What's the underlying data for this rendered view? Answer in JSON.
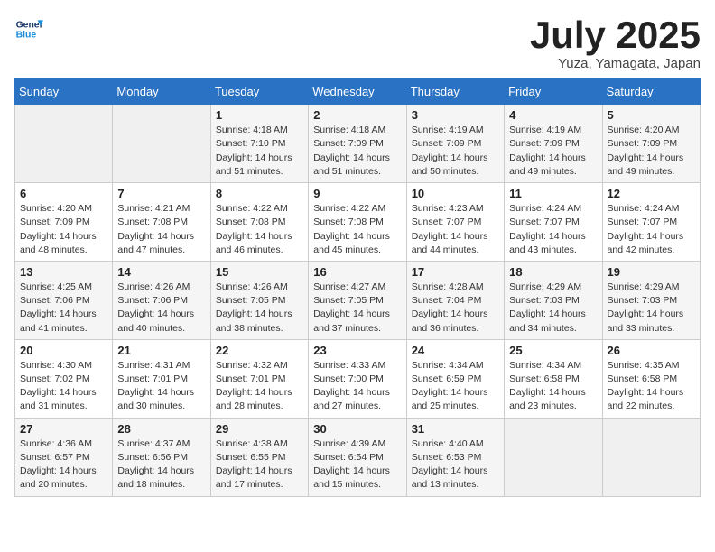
{
  "header": {
    "logo_line1": "General",
    "logo_line2": "Blue",
    "month_title": "July 2025",
    "location": "Yuza, Yamagata, Japan"
  },
  "weekdays": [
    "Sunday",
    "Monday",
    "Tuesday",
    "Wednesday",
    "Thursday",
    "Friday",
    "Saturday"
  ],
  "weeks": [
    [
      {
        "day": "",
        "sunrise": "",
        "sunset": "",
        "daylight": ""
      },
      {
        "day": "",
        "sunrise": "",
        "sunset": "",
        "daylight": ""
      },
      {
        "day": "1",
        "sunrise": "Sunrise: 4:18 AM",
        "sunset": "Sunset: 7:10 PM",
        "daylight": "Daylight: 14 hours and 51 minutes."
      },
      {
        "day": "2",
        "sunrise": "Sunrise: 4:18 AM",
        "sunset": "Sunset: 7:09 PM",
        "daylight": "Daylight: 14 hours and 51 minutes."
      },
      {
        "day": "3",
        "sunrise": "Sunrise: 4:19 AM",
        "sunset": "Sunset: 7:09 PM",
        "daylight": "Daylight: 14 hours and 50 minutes."
      },
      {
        "day": "4",
        "sunrise": "Sunrise: 4:19 AM",
        "sunset": "Sunset: 7:09 PM",
        "daylight": "Daylight: 14 hours and 49 minutes."
      },
      {
        "day": "5",
        "sunrise": "Sunrise: 4:20 AM",
        "sunset": "Sunset: 7:09 PM",
        "daylight": "Daylight: 14 hours and 49 minutes."
      }
    ],
    [
      {
        "day": "6",
        "sunrise": "Sunrise: 4:20 AM",
        "sunset": "Sunset: 7:09 PM",
        "daylight": "Daylight: 14 hours and 48 minutes."
      },
      {
        "day": "7",
        "sunrise": "Sunrise: 4:21 AM",
        "sunset": "Sunset: 7:08 PM",
        "daylight": "Daylight: 14 hours and 47 minutes."
      },
      {
        "day": "8",
        "sunrise": "Sunrise: 4:22 AM",
        "sunset": "Sunset: 7:08 PM",
        "daylight": "Daylight: 14 hours and 46 minutes."
      },
      {
        "day": "9",
        "sunrise": "Sunrise: 4:22 AM",
        "sunset": "Sunset: 7:08 PM",
        "daylight": "Daylight: 14 hours and 45 minutes."
      },
      {
        "day": "10",
        "sunrise": "Sunrise: 4:23 AM",
        "sunset": "Sunset: 7:07 PM",
        "daylight": "Daylight: 14 hours and 44 minutes."
      },
      {
        "day": "11",
        "sunrise": "Sunrise: 4:24 AM",
        "sunset": "Sunset: 7:07 PM",
        "daylight": "Daylight: 14 hours and 43 minutes."
      },
      {
        "day": "12",
        "sunrise": "Sunrise: 4:24 AM",
        "sunset": "Sunset: 7:07 PM",
        "daylight": "Daylight: 14 hours and 42 minutes."
      }
    ],
    [
      {
        "day": "13",
        "sunrise": "Sunrise: 4:25 AM",
        "sunset": "Sunset: 7:06 PM",
        "daylight": "Daylight: 14 hours and 41 minutes."
      },
      {
        "day": "14",
        "sunrise": "Sunrise: 4:26 AM",
        "sunset": "Sunset: 7:06 PM",
        "daylight": "Daylight: 14 hours and 40 minutes."
      },
      {
        "day": "15",
        "sunrise": "Sunrise: 4:26 AM",
        "sunset": "Sunset: 7:05 PM",
        "daylight": "Daylight: 14 hours and 38 minutes."
      },
      {
        "day": "16",
        "sunrise": "Sunrise: 4:27 AM",
        "sunset": "Sunset: 7:05 PM",
        "daylight": "Daylight: 14 hours and 37 minutes."
      },
      {
        "day": "17",
        "sunrise": "Sunrise: 4:28 AM",
        "sunset": "Sunset: 7:04 PM",
        "daylight": "Daylight: 14 hours and 36 minutes."
      },
      {
        "day": "18",
        "sunrise": "Sunrise: 4:29 AM",
        "sunset": "Sunset: 7:03 PM",
        "daylight": "Daylight: 14 hours and 34 minutes."
      },
      {
        "day": "19",
        "sunrise": "Sunrise: 4:29 AM",
        "sunset": "Sunset: 7:03 PM",
        "daylight": "Daylight: 14 hours and 33 minutes."
      }
    ],
    [
      {
        "day": "20",
        "sunrise": "Sunrise: 4:30 AM",
        "sunset": "Sunset: 7:02 PM",
        "daylight": "Daylight: 14 hours and 31 minutes."
      },
      {
        "day": "21",
        "sunrise": "Sunrise: 4:31 AM",
        "sunset": "Sunset: 7:01 PM",
        "daylight": "Daylight: 14 hours and 30 minutes."
      },
      {
        "day": "22",
        "sunrise": "Sunrise: 4:32 AM",
        "sunset": "Sunset: 7:01 PM",
        "daylight": "Daylight: 14 hours and 28 minutes."
      },
      {
        "day": "23",
        "sunrise": "Sunrise: 4:33 AM",
        "sunset": "Sunset: 7:00 PM",
        "daylight": "Daylight: 14 hours and 27 minutes."
      },
      {
        "day": "24",
        "sunrise": "Sunrise: 4:34 AM",
        "sunset": "Sunset: 6:59 PM",
        "daylight": "Daylight: 14 hours and 25 minutes."
      },
      {
        "day": "25",
        "sunrise": "Sunrise: 4:34 AM",
        "sunset": "Sunset: 6:58 PM",
        "daylight": "Daylight: 14 hours and 23 minutes."
      },
      {
        "day": "26",
        "sunrise": "Sunrise: 4:35 AM",
        "sunset": "Sunset: 6:58 PM",
        "daylight": "Daylight: 14 hours and 22 minutes."
      }
    ],
    [
      {
        "day": "27",
        "sunrise": "Sunrise: 4:36 AM",
        "sunset": "Sunset: 6:57 PM",
        "daylight": "Daylight: 14 hours and 20 minutes."
      },
      {
        "day": "28",
        "sunrise": "Sunrise: 4:37 AM",
        "sunset": "Sunset: 6:56 PM",
        "daylight": "Daylight: 14 hours and 18 minutes."
      },
      {
        "day": "29",
        "sunrise": "Sunrise: 4:38 AM",
        "sunset": "Sunset: 6:55 PM",
        "daylight": "Daylight: 14 hours and 17 minutes."
      },
      {
        "day": "30",
        "sunrise": "Sunrise: 4:39 AM",
        "sunset": "Sunset: 6:54 PM",
        "daylight": "Daylight: 14 hours and 15 minutes."
      },
      {
        "day": "31",
        "sunrise": "Sunrise: 4:40 AM",
        "sunset": "Sunset: 6:53 PM",
        "daylight": "Daylight: 14 hours and 13 minutes."
      },
      {
        "day": "",
        "sunrise": "",
        "sunset": "",
        "daylight": ""
      },
      {
        "day": "",
        "sunrise": "",
        "sunset": "",
        "daylight": ""
      }
    ]
  ]
}
